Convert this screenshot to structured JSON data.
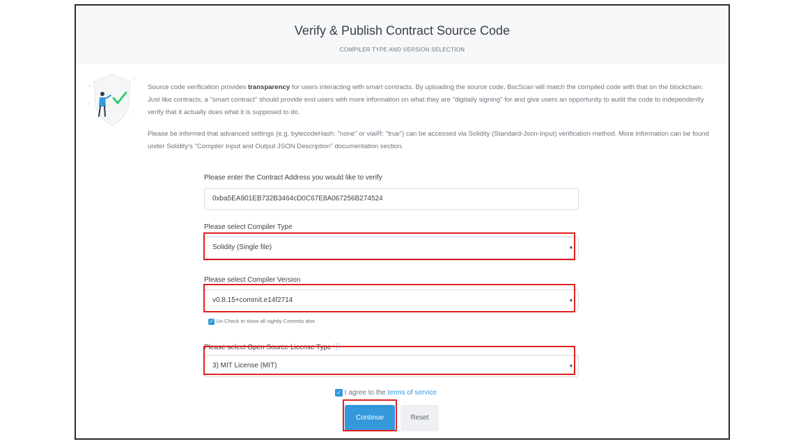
{
  "header": {
    "title": "Verify & Publish Contract Source Code",
    "subtitle": "COMPILER TYPE AND VERSION SELECTION"
  },
  "intro": {
    "p1_a": "Source code verification provides ",
    "p1_bold": "transparency",
    "p1_b": " for users interacting with smart contracts. By uploading the source code, BscScan will match the compiled code with that on the blockchain. Just like contracts, a \"smart contract\" should provide end users with more information on what they are \"digitally signing\" for and give users an opportunity to audit the code to independently verify that it actually does what it is supposed to do.",
    "p2": "Please be informed that advanced settings (e.g. bytecodeHash: \"none\" or viaIR: \"true\") can be accessed via Solidity (Standard-Json-Input) verification method. More information can be found under Solidity's \"Compiler Input and Output JSON Description\" documentation section."
  },
  "form": {
    "address_label": "Please enter the Contract Address you would like to verify",
    "address_value": "0xba5EA901EB732B3464cD0C67E8A067256B274524",
    "compiler_type_label": "Please select Compiler Type",
    "compiler_type_value": "Solidity (Single file)",
    "compiler_version_label": "Please select Compiler Version",
    "compiler_version_value": "v0.8.15+commit.e14f2714",
    "nightly_label": "Un-Check to show all nightly Commits also",
    "license_label": "Please select Open Source License Type",
    "license_value": "3) MIT License (MIT)",
    "tos_prefix": "I agree to the ",
    "tos_link": "terms of service",
    "continue_label": "Continue",
    "reset_label": "Reset"
  },
  "icons": {
    "info": "info-icon",
    "caret": "select-caret-icon",
    "check": "checkmark-icon"
  },
  "colors": {
    "accent": "#3498db",
    "highlight": "#e02020",
    "header_bg": "#f7f8f9"
  }
}
